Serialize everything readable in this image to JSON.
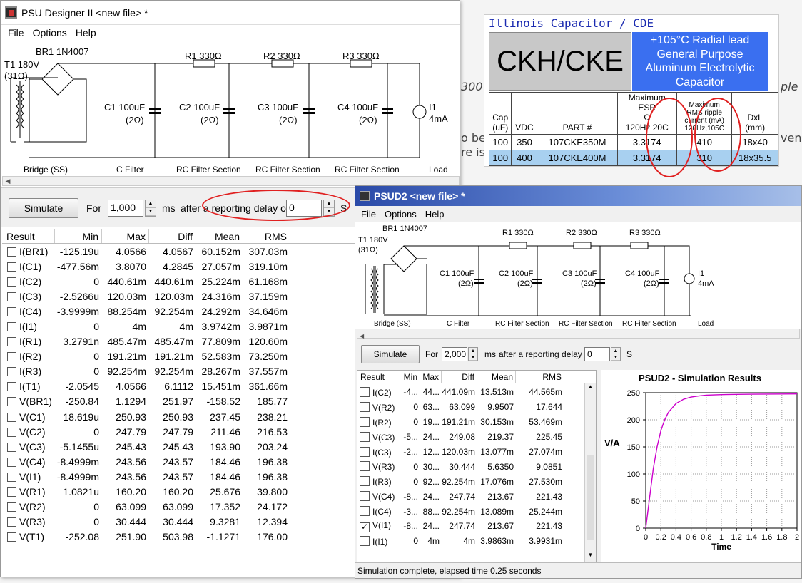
{
  "background": {
    "fragments": [
      "300",
      "ple",
      "o be",
      "ven",
      "re is"
    ]
  },
  "window1": {
    "title": "PSU Designer II  <new file> *",
    "menu": [
      "File",
      "Options",
      "Help"
    ],
    "schematic": {
      "br1": "BR1 1N4007",
      "t1": "T1 180V",
      "t1r": "(31Ω)",
      "r1": "R1 330Ω",
      "r2": "R2 330Ω",
      "r3": "R3 330Ω",
      "c1": "C1 100uF",
      "c2": "C2 100uF",
      "c3": "C3 100uF",
      "c4": "C4 100uF",
      "esr": "(2Ω)",
      "i1": "I1",
      "i1v": "4mA",
      "sections": [
        "Bridge (SS)",
        "C Filter",
        "RC Filter Section",
        "RC Filter Section",
        "RC Filter Section",
        "Load"
      ]
    },
    "simulate_label": "Simulate",
    "for_label": "For",
    "duration": "1,000",
    "ms_label": "ms",
    "after_label": "after a reporting delay of",
    "delay": "0",
    "s_label": "S",
    "columns": [
      "Result",
      "Min",
      "Max",
      "Diff",
      "Mean",
      "RMS"
    ],
    "rows": [
      [
        "I(BR1)",
        "-125.19u",
        "4.0566",
        "4.0567",
        "60.152m",
        "307.03m"
      ],
      [
        "I(C1)",
        "-477.56m",
        "3.8070",
        "4.2845",
        "27.057m",
        "319.10m"
      ],
      [
        "I(C2)",
        "0",
        "440.61m",
        "440.61m",
        "25.224m",
        "61.168m"
      ],
      [
        "I(C3)",
        "-2.5266u",
        "120.03m",
        "120.03m",
        "24.316m",
        "37.159m"
      ],
      [
        "I(C4)",
        "-3.9999m",
        "88.254m",
        "92.254m",
        "24.292m",
        "34.646m"
      ],
      [
        "I(I1)",
        "0",
        "4m",
        "4m",
        "3.9742m",
        "3.9871m"
      ],
      [
        "I(R1)",
        "3.2791n",
        "485.47m",
        "485.47m",
        "77.809m",
        "120.60m"
      ],
      [
        "I(R2)",
        "0",
        "191.21m",
        "191.21m",
        "52.583m",
        "73.250m"
      ],
      [
        "I(R3)",
        "0",
        "92.254m",
        "92.254m",
        "28.267m",
        "37.557m"
      ],
      [
        "I(T1)",
        "-2.0545",
        "4.0566",
        "6.1112",
        "15.451m",
        "361.66m"
      ],
      [
        "V(BR1)",
        "-250.84",
        "1.1294",
        "251.97",
        "-158.52",
        "185.77"
      ],
      [
        "V(C1)",
        "18.619u",
        "250.93",
        "250.93",
        "237.45",
        "238.21"
      ],
      [
        "V(C2)",
        "0",
        "247.79",
        "247.79",
        "211.46",
        "216.53"
      ],
      [
        "V(C3)",
        "-5.1455u",
        "245.43",
        "245.43",
        "193.90",
        "203.24"
      ],
      [
        "V(C4)",
        "-8.4999m",
        "243.56",
        "243.57",
        "184.46",
        "196.38"
      ],
      [
        "V(I1)",
        "-8.4999m",
        "243.56",
        "243.57",
        "184.46",
        "196.38"
      ],
      [
        "V(R1)",
        "1.0821u",
        "160.20",
        "160.20",
        "25.676",
        "39.800"
      ],
      [
        "V(R2)",
        "0",
        "63.099",
        "63.099",
        "17.352",
        "24.172"
      ],
      [
        "V(R3)",
        "0",
        "30.444",
        "30.444",
        "9.3281",
        "12.394"
      ],
      [
        "V(T1)",
        "-252.08",
        "251.90",
        "503.98",
        "-1.1271",
        "176.00"
      ]
    ]
  },
  "capacitor": {
    "maker": "Illinois Capacitor / CDE",
    "series": "CKH/CKE",
    "desc": [
      "+105°C Radial lead",
      "General Purpose",
      "Aluminum Electrolytic",
      "Capacitor"
    ],
    "headers": [
      [
        "Cap",
        "(uF)"
      ],
      [
        "VDC"
      ],
      [
        "PART #"
      ],
      [
        "Maximum",
        "ESR",
        "Ω",
        "120Hz  20C"
      ],
      [
        "Maximum",
        "RMS ripple",
        "current (mA)",
        "120Hz,105C"
      ],
      [
        "DxL",
        "(mm)"
      ]
    ],
    "rows": [
      [
        "100",
        "350",
        "107CKE350M",
        "3.3174",
        "410",
        "18x40"
      ],
      [
        "100",
        "400",
        "107CKE400M",
        "3.3174",
        "310",
        "18x35.5"
      ]
    ]
  },
  "window2": {
    "title": "PSUD2  <new file> *",
    "menu": [
      "File",
      "Options",
      "Help"
    ],
    "simulate_label": "Simulate",
    "for_label": "For",
    "duration": "2,000",
    "ms_label": "ms",
    "after_label": "after a reporting delay of",
    "delay": "0",
    "s_label": "S",
    "columns": [
      "Result",
      "Min",
      "Max",
      "Diff",
      "Mean",
      "RMS"
    ],
    "rows": [
      {
        "name": "I(C2)",
        "checked": false,
        "vals": [
          "-4...",
          "44...",
          "441.09m",
          "13.513m",
          "44.565m"
        ]
      },
      {
        "name": "V(R2)",
        "checked": false,
        "vals": [
          "0",
          "63...",
          "63.099",
          "9.9507",
          "17.644"
        ]
      },
      {
        "name": "I(R2)",
        "checked": false,
        "vals": [
          "0",
          "19...",
          "191.21m",
          "30.153m",
          "53.469m"
        ]
      },
      {
        "name": "V(C3)",
        "checked": false,
        "vals": [
          "-5...",
          "24...",
          "249.08",
          "219.37",
          "225.45"
        ]
      },
      {
        "name": "I(C3)",
        "checked": false,
        "vals": [
          "-2...",
          "12...",
          "120.03m",
          "13.077m",
          "27.074m"
        ]
      },
      {
        "name": "V(R3)",
        "checked": false,
        "vals": [
          "0",
          "30...",
          "30.444",
          "5.6350",
          "9.0851"
        ]
      },
      {
        "name": "I(R3)",
        "checked": false,
        "vals": [
          "0",
          "92...",
          "92.254m",
          "17.076m",
          "27.530m"
        ]
      },
      {
        "name": "V(C4)",
        "checked": false,
        "vals": [
          "-8...",
          "24...",
          "247.74",
          "213.67",
          "221.43"
        ]
      },
      {
        "name": "I(C4)",
        "checked": false,
        "vals": [
          "-3...",
          "88...",
          "92.254m",
          "13.089m",
          "25.244m"
        ]
      },
      {
        "name": "V(I1)",
        "checked": true,
        "vals": [
          "-8...",
          "24...",
          "247.74",
          "213.67",
          "221.43"
        ]
      },
      {
        "name": "I(I1)",
        "checked": false,
        "vals": [
          "0",
          "4m",
          "4m",
          "3.9863m",
          "3.9931m"
        ]
      }
    ],
    "status": "Simulation complete, elapsed time 0.25 seconds"
  },
  "chart_data": {
    "type": "line",
    "title": "PSUD2 - Simulation Results",
    "xlabel": "Time",
    "ylabel": "V/A",
    "xlim": [
      0,
      2
    ],
    "ylim": [
      0,
      250
    ],
    "xticks": [
      "0",
      "0.2",
      "0.4",
      "0.6",
      "0.8",
      "1",
      "1.2",
      "1.4",
      "1.6",
      "1.8",
      "2"
    ],
    "yticks": [
      "0",
      "50",
      "100",
      "150",
      "200",
      "250"
    ],
    "grid": true,
    "color": "#cc00cc",
    "series": [
      {
        "x": [
          0,
          0.05,
          0.1,
          0.15,
          0.2,
          0.25,
          0.3,
          0.4,
          0.5,
          0.6,
          0.7,
          0.8,
          1.0,
          1.2,
          1.4,
          1.6,
          1.8,
          2.0
        ],
        "values": [
          0,
          55,
          110,
          150,
          180,
          200,
          214,
          230,
          238,
          242,
          244,
          245.5,
          246.5,
          247,
          247.3,
          247.5,
          247.6,
          247.7
        ]
      }
    ]
  }
}
